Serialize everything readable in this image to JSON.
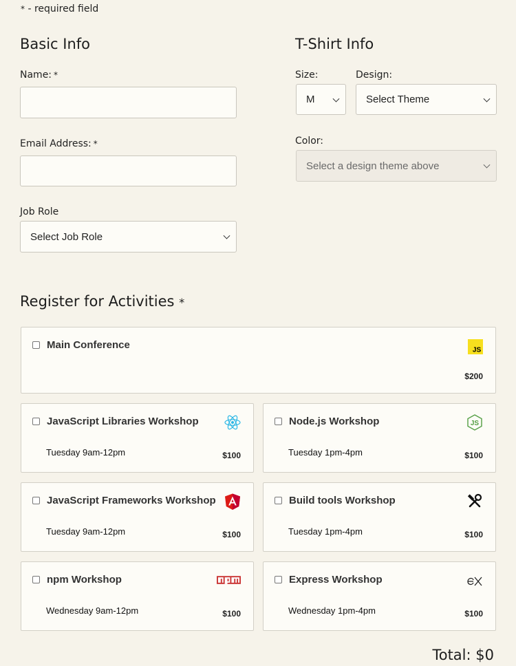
{
  "required_note": {
    "star": "*",
    "text": " - required field"
  },
  "basic_info": {
    "heading": "Basic Info",
    "name_label": "Name:",
    "email_label": "Email Address:",
    "job_role_label": "Job Role",
    "job_role_value": "Select Job Role",
    "star": "*"
  },
  "tshirt_info": {
    "heading": "T-Shirt Info",
    "size_label": "Size:",
    "size_value": "M",
    "design_label": "Design:",
    "design_value": "Select Theme",
    "color_label": "Color:",
    "color_value": "Select a design theme above"
  },
  "activities": {
    "heading": "Register for Activities",
    "star": "*",
    "items": [
      {
        "name": "Main Conference",
        "time": "",
        "price": "$200",
        "icon": "javascript-logo-icon"
      },
      {
        "name": "JavaScript Libraries Workshop",
        "time": "Tuesday 9am-12pm",
        "price": "$100",
        "icon": "react-logo-icon"
      },
      {
        "name": "Node.js Workshop",
        "time": "Tuesday 1pm-4pm",
        "price": "$100",
        "icon": "nodejs-logo-icon"
      },
      {
        "name": "JavaScript Frameworks Workshop",
        "time": "Tuesday 9am-12pm",
        "price": "$100",
        "icon": "angular-logo-icon"
      },
      {
        "name": "Build tools Workshop",
        "time": "Tuesday 1pm-4pm",
        "price": "$100",
        "icon": "build-tools-icon"
      },
      {
        "name": "npm Workshop",
        "time": "Wednesday 9am-12pm",
        "price": "$100",
        "icon": "npm-logo-icon"
      },
      {
        "name": "Express Workshop",
        "time": "Wednesday 1pm-4pm",
        "price": "$100",
        "icon": "express-logo-icon"
      }
    ],
    "total": "Total: $0"
  },
  "colors": {
    "background": "#f6f3ea",
    "input_bg": "#fdfcf7",
    "js_yellow": "#f7df1e",
    "react_cyan": "#61dafb",
    "node_green": "#539e43",
    "angular_red": "#dd1b16",
    "npm_red": "#cb3837"
  }
}
